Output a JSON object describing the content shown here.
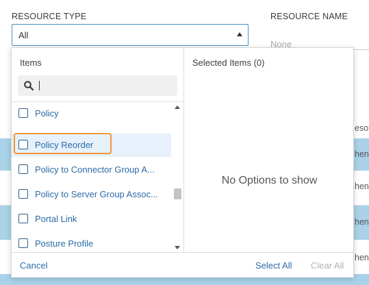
{
  "filters": {
    "resource_type": {
      "label": "RESOURCE TYPE",
      "value": "All"
    },
    "resource_name": {
      "label": "RESOURCE NAME",
      "placeholder": "None"
    }
  },
  "dropdown": {
    "items_title": "Items",
    "search": {
      "value": ""
    },
    "list": [
      {
        "label": "Policy",
        "checked": false
      },
      {
        "label": "Policy Reorder",
        "checked": false,
        "highlighted": true
      },
      {
        "label": "Policy to Connector Group A...",
        "checked": false
      },
      {
        "label": "Policy to Server Group Assoc...",
        "checked": false
      },
      {
        "label": "Portal Link",
        "checked": false
      },
      {
        "label": "Posture Profile",
        "checked": false
      }
    ],
    "selected_title": "Selected Items (0)",
    "empty_message": "No Options to show",
    "footer": {
      "cancel": "Cancel",
      "select_all": "Select All",
      "clear_all": "Clear All"
    }
  },
  "background_table": {
    "rows": [
      {
        "text": "esour",
        "color": "white"
      },
      {
        "text": "hent",
        "color": "blue"
      },
      {
        "text": "hent",
        "color": "white"
      },
      {
        "text": "hent",
        "color": "blue"
      },
      {
        "text": "hent",
        "color": "white"
      }
    ]
  },
  "colors": {
    "accent": "#2b6aa6",
    "focus": "#f19634",
    "row_highlight": "#a9d2e8",
    "item_hover": "#e6f1fb",
    "disabled": "#b0b0b0"
  }
}
